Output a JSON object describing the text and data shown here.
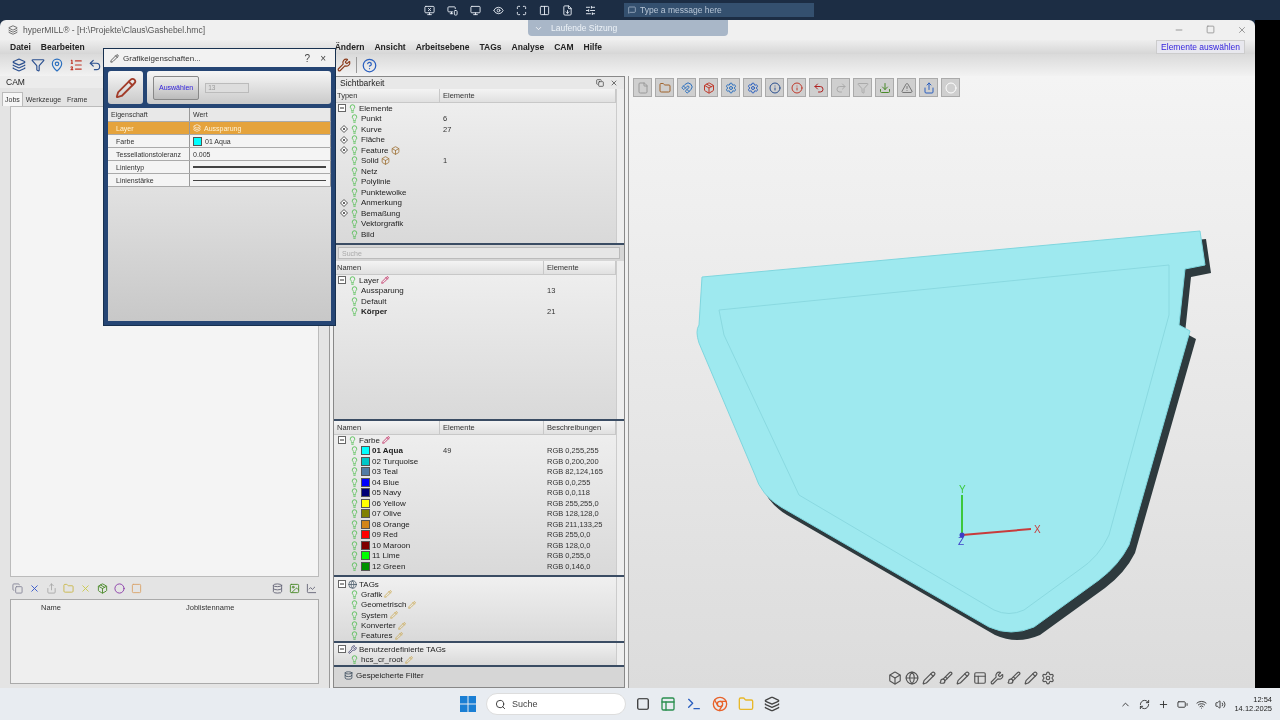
{
  "remote_bar": {
    "message_placeholder": "Type a message here",
    "session_label": "Laufende Sitzung"
  },
  "window": {
    "title": "hyperMILL® - [H:\\Projekte\\Claus\\Gashebel.hmc]"
  },
  "menu_left": [
    {
      "label": "Datei"
    },
    {
      "label": "Bearbeiten"
    }
  ],
  "menu_right": [
    {
      "label": "Ändern"
    },
    {
      "label": "Ansicht"
    },
    {
      "label": "Arbeitsebene"
    },
    {
      "label": "TAGs"
    },
    {
      "label": "Analyse"
    },
    {
      "label": "CAM"
    },
    {
      "label": "Hilfe"
    }
  ],
  "select_button": "Elemente auswählen",
  "cam_panel": {
    "title": "CAM",
    "tabs": [
      {
        "label": "Jobs",
        "selected": true
      },
      {
        "label": "Werkzeuge",
        "selected": false
      },
      {
        "label": "Frame",
        "selected": false
      }
    ],
    "list_columns": [
      "Name",
      "Joblistenname"
    ]
  },
  "visibility_panel": {
    "title": "Sichtbarkeit",
    "types": {
      "columns": [
        "Typen",
        "Elemente"
      ],
      "root": "Elemente",
      "items": [
        {
          "label": "Punkt",
          "count": "6",
          "filter": false,
          "marker": false
        },
        {
          "label": "Kurve",
          "count": "27",
          "filter": true,
          "marker": false
        },
        {
          "label": "Fläche",
          "filter": true,
          "marker": false
        },
        {
          "label": "Feature",
          "filter": true,
          "marker": true
        },
        {
          "label": "Solid",
          "count": "1",
          "filter": false,
          "marker": true
        },
        {
          "label": "Netz",
          "filter": false,
          "marker": false
        },
        {
          "label": "Polylinie",
          "filter": false,
          "marker": false
        },
        {
          "label": "Punktewolke",
          "filter": false,
          "marker": false
        },
        {
          "label": "Anmerkung",
          "filter": true,
          "marker": false
        },
        {
          "label": "Bemaßung",
          "filter": true,
          "marker": false
        },
        {
          "label": "Vektorgrafik",
          "filter": false,
          "marker": false
        },
        {
          "label": "Bild",
          "filter": false,
          "marker": false
        }
      ]
    },
    "search": {
      "placeholder": "Suche"
    },
    "layers": {
      "columns": [
        "Namen",
        "Elemente"
      ],
      "root": "Layer",
      "items": [
        {
          "label": "Aussparung",
          "count": "13",
          "active": false
        },
        {
          "label": "Default",
          "active": false
        },
        {
          "label": "Körper",
          "count": "21",
          "active": true
        }
      ]
    },
    "colors": {
      "columns": [
        "Namen",
        "Elemente",
        "Beschreibungen"
      ],
      "root": "Farbe",
      "items": [
        {
          "label": "01 Aqua",
          "count": "49",
          "description": "RGB 0,255,255",
          "color": "#00ffff",
          "active": true
        },
        {
          "label": "02 Turquoise",
          "description": "RGB 0,200,200",
          "color": "#00c8c8",
          "active": false
        },
        {
          "label": "03 Teal",
          "description": "RGB 82,124,165",
          "color": "#527ca5",
          "active": false
        },
        {
          "label": "04 Blue",
          "description": "RGB 0,0,255",
          "color": "#0000ff",
          "active": false
        },
        {
          "label": "05 Navy",
          "description": "RGB 0,0,118",
          "color": "#000076",
          "active": false
        },
        {
          "label": "06 Yellow",
          "description": "RGB 255,255,0",
          "color": "#ffff00",
          "active": false
        },
        {
          "label": "07 Olive",
          "description": "RGB 128,128,0",
          "color": "#808000",
          "active": false
        },
        {
          "label": "08 Orange",
          "description": "RGB 211,133,25",
          "color": "#d38519",
          "active": false
        },
        {
          "label": "09 Red",
          "description": "RGB 255,0,0",
          "color": "#ff0000",
          "active": false
        },
        {
          "label": "10 Maroon",
          "description": "RGB 128,0,0",
          "color": "#800000",
          "active": false
        },
        {
          "label": "11 Lime",
          "description": "RGB 0,255,0",
          "color": "#00ff00",
          "active": false
        },
        {
          "label": "12 Green",
          "description": "RGB 0,146,0",
          "color": "#009200",
          "active": false
        }
      ]
    },
    "tags": {
      "root": "TAGs",
      "items": [
        {
          "label": "Grafik"
        },
        {
          "label": "Geometrisch"
        },
        {
          "label": "System"
        },
        {
          "label": "Konverter"
        },
        {
          "label": "Features"
        }
      ]
    },
    "custom_tags": {
      "root": "Benutzerdefinierte TAGs",
      "items": [
        {
          "label": "hcs_cr_root"
        }
      ]
    },
    "saved_filters": "Gespeicherte Filter"
  },
  "dialog": {
    "title": "Grafikeigenschaften...",
    "help": "?",
    "close": "×",
    "select_button": "Auswählen",
    "count_value": "13",
    "columns": [
      "Eigenschaft",
      "Wert"
    ],
    "rows": [
      {
        "property": "Layer",
        "kind": "layer",
        "value": "Aussparung",
        "selected": true
      },
      {
        "property": "Farbe",
        "kind": "swatch",
        "value": "01 Aqua",
        "color": "#00ffff",
        "selected": false
      },
      {
        "property": "Tessellationstoleranz",
        "kind": "text",
        "value": "0.005",
        "selected": false
      },
      {
        "property": "Linientyp",
        "kind": "heavyline",
        "selected": false
      },
      {
        "property": "Linienstärke",
        "kind": "lightline",
        "selected": false
      }
    ]
  },
  "viewport": {
    "axes": [
      "Y",
      "Z",
      "X"
    ]
  },
  "taskbar": {
    "search_placeholder": "Suche",
    "time": "12:54",
    "date": "14.12.2025"
  }
}
